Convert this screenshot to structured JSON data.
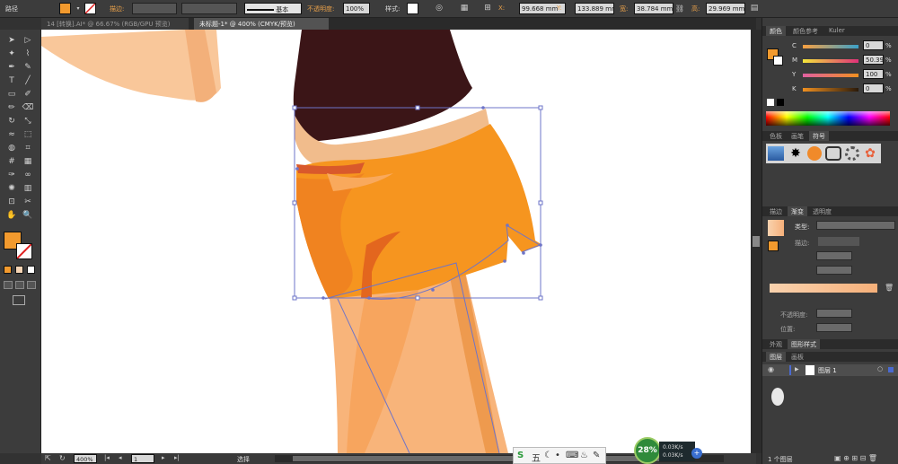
{
  "control_bar": {
    "selection_label": "路径",
    "stroke_label": "描边:",
    "stroke_profile": "基本",
    "opacity_label": "不透明度:",
    "opacity_value": "100%",
    "style_label": "样式:",
    "x_label": "X:",
    "x_value": "99.668 mm",
    "y_label": "Y:",
    "y_value": "133.889 mm",
    "w_label": "宽:",
    "w_value": "38.784 mm",
    "h_label": "高:",
    "h_value": "29.969 mm",
    "fill_color": "#F29A2E"
  },
  "tabs": [
    {
      "label": "14 [转换].AI* @ 66.67% (RGB/GPU 预览)",
      "active": false
    },
    {
      "label": "未标题-1* @ 400% (CMYK/预览)",
      "active": true
    }
  ],
  "toolbar": {
    "fill_color": "#F29A2E",
    "tools": [
      "selection-tool",
      "direct-selection-tool",
      "magic-wand-tool",
      "lasso-tool",
      "pen-tool",
      "curvature-tool",
      "type-tool",
      "line-tool",
      "rectangle-tool",
      "paintbrush-tool",
      "pencil-tool",
      "eraser-tool",
      "rotate-tool",
      "scale-tool",
      "warp-tool",
      "free-transform-tool",
      "shape-builder-tool",
      "perspective-tool",
      "mesh-tool",
      "gradient-tool",
      "eyedropper-tool",
      "blend-tool",
      "symbol-sprayer-tool",
      "column-graph-tool",
      "artboard-tool",
      "slice-tool",
      "hand-tool",
      "zoom-tool"
    ]
  },
  "status_bar": {
    "zoom": "400%",
    "artboard": "1",
    "mode": "选择"
  },
  "panels": {
    "color_tabs": [
      "颜色",
      "颜色参考",
      "Kuler"
    ],
    "cmyk": [
      {
        "key": "C",
        "value": "0",
        "unit": "%"
      },
      {
        "key": "M",
        "value": "50.39",
        "unit": "%"
      },
      {
        "key": "Y",
        "value": "100",
        "unit": "%"
      },
      {
        "key": "K",
        "value": "0",
        "unit": "%"
      }
    ],
    "swatch_tabs": [
      "色板",
      "画笔",
      "符号"
    ],
    "gradient_tabs": [
      "描边",
      "渐变",
      "透明度"
    ],
    "gradient_type_label": "类型:",
    "gradient_stroke_label": "描边:",
    "gradient_opacity_label": "不透明度:",
    "gradient_position_label": "位置:",
    "appearance_tabs": [
      "外观",
      "图形样式"
    ],
    "layers_tabs": [
      "图层",
      "画板"
    ],
    "layer_name": "图层 1",
    "layer_count": "1 个图层"
  },
  "taskbar": {
    "ime_label": "五",
    "network_percent": "28%",
    "upload_speed": "0.03K/s",
    "download_speed": "0.03K/s"
  }
}
